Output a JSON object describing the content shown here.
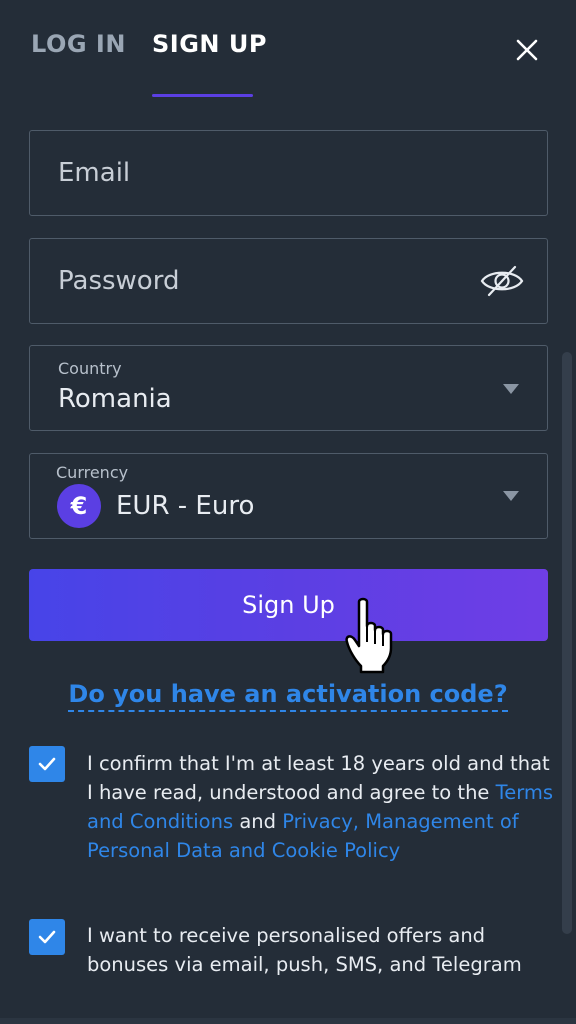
{
  "tabs": {
    "login": "LOG IN",
    "signup": "SIGN UP"
  },
  "icons": {
    "close": "close-icon",
    "eye": "eye-slash-icon",
    "chevron": "chevron-down-icon",
    "checkmark": "checkmark-icon",
    "cursor": "hand-pointer-icon"
  },
  "form": {
    "email_placeholder": "Email",
    "password_placeholder": "Password",
    "country": {
      "label": "Country",
      "value": "Romania"
    },
    "currency": {
      "label": "Currency",
      "symbol": "€",
      "value": "EUR - Euro"
    },
    "submit_label": "Sign Up"
  },
  "activation_link": "Do you have an activation code?",
  "consents": {
    "age": {
      "checked": true,
      "text_before": "I confirm that I'm at least 18 years old and that I have read, understood and agree to the",
      "terms_link": "Terms and Conditions",
      "and": "and",
      "privacy_link": "Privacy, Management of Personal Data and Cookie Policy"
    },
    "offers": {
      "checked": true,
      "text": "I want to receive personalised offers and bonuses via email, push, SMS, and Telegram"
    }
  },
  "colors": {
    "background": "#242d38",
    "accent": "#5b3fe3",
    "link": "#2f86e8",
    "border": "#4f5b69",
    "text": "#e8ecf1",
    "muted_text": "#9aa6b4"
  }
}
